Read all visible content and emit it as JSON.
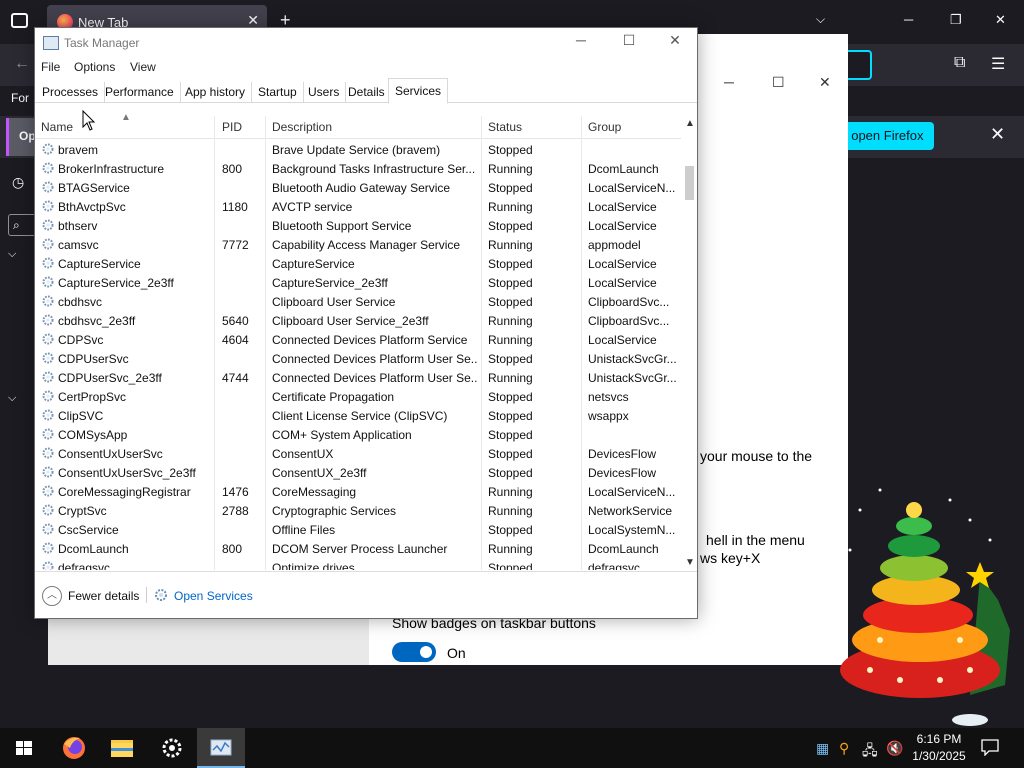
{
  "firefox": {
    "tab_title": "New Tab",
    "new_tab_symbol": "+",
    "sidebar_for": "For",
    "notif_op": "Op",
    "open_button": ", open Firefox",
    "window_controls": [
      "minimize-icon",
      "restore-icon",
      "close-icon"
    ]
  },
  "settings": {
    "mouse_text": "your mouse to the",
    "shell_text": "hell in the menu",
    "winx_text": "ws key+X",
    "badges_label": "Show badges on taskbar buttons",
    "toggle_state": "On"
  },
  "task_manager": {
    "title": "Task Manager",
    "menu": [
      "File",
      "Options",
      "View"
    ],
    "tabs": [
      "Processes",
      "Performance",
      "App history",
      "Startup",
      "Users",
      "Details",
      "Services"
    ],
    "active_tab": "Services",
    "columns": [
      "Name",
      "PID",
      "Description",
      "Status",
      "Group"
    ],
    "services": [
      {
        "name": "bravem",
        "pid": "",
        "description": "Brave Update Service (bravem)",
        "status": "Stopped",
        "group": ""
      },
      {
        "name": "BrokerInfrastructure",
        "pid": "800",
        "description": "Background Tasks Infrastructure Ser...",
        "status": "Running",
        "group": "DcomLaunch"
      },
      {
        "name": "BTAGService",
        "pid": "",
        "description": "Bluetooth Audio Gateway Service",
        "status": "Stopped",
        "group": "LocalServiceN..."
      },
      {
        "name": "BthAvctpSvc",
        "pid": "1180",
        "description": "AVCTP service",
        "status": "Running",
        "group": "LocalService"
      },
      {
        "name": "bthserv",
        "pid": "",
        "description": "Bluetooth Support Service",
        "status": "Stopped",
        "group": "LocalService"
      },
      {
        "name": "camsvc",
        "pid": "7772",
        "description": "Capability Access Manager Service",
        "status": "Running",
        "group": "appmodel"
      },
      {
        "name": "CaptureService",
        "pid": "",
        "description": "CaptureService",
        "status": "Stopped",
        "group": "LocalService"
      },
      {
        "name": "CaptureService_2e3ff",
        "pid": "",
        "description": "CaptureService_2e3ff",
        "status": "Stopped",
        "group": "LocalService"
      },
      {
        "name": "cbdhsvc",
        "pid": "",
        "description": "Clipboard User Service",
        "status": "Stopped",
        "group": "ClipboardSvc..."
      },
      {
        "name": "cbdhsvc_2e3ff",
        "pid": "5640",
        "description": "Clipboard User Service_2e3ff",
        "status": "Running",
        "group": "ClipboardSvc..."
      },
      {
        "name": "CDPSvc",
        "pid": "4604",
        "description": "Connected Devices Platform Service",
        "status": "Running",
        "group": "LocalService"
      },
      {
        "name": "CDPUserSvc",
        "pid": "",
        "description": "Connected Devices Platform User Se...",
        "status": "Stopped",
        "group": "UnistackSvcGr..."
      },
      {
        "name": "CDPUserSvc_2e3ff",
        "pid": "4744",
        "description": "Connected Devices Platform User Se...",
        "status": "Running",
        "group": "UnistackSvcGr..."
      },
      {
        "name": "CertPropSvc",
        "pid": "",
        "description": "Certificate Propagation",
        "status": "Stopped",
        "group": "netsvcs"
      },
      {
        "name": "ClipSVC",
        "pid": "",
        "description": "Client License Service (ClipSVC)",
        "status": "Stopped",
        "group": "wsappx"
      },
      {
        "name": "COMSysApp",
        "pid": "",
        "description": "COM+ System Application",
        "status": "Stopped",
        "group": ""
      },
      {
        "name": "ConsentUxUserSvc",
        "pid": "",
        "description": "ConsentUX",
        "status": "Stopped",
        "group": "DevicesFlow"
      },
      {
        "name": "ConsentUxUserSvc_2e3ff",
        "pid": "",
        "description": "ConsentUX_2e3ff",
        "status": "Stopped",
        "group": "DevicesFlow"
      },
      {
        "name": "CoreMessagingRegistrar",
        "pid": "1476",
        "description": "CoreMessaging",
        "status": "Running",
        "group": "LocalServiceN..."
      },
      {
        "name": "CryptSvc",
        "pid": "2788",
        "description": "Cryptographic Services",
        "status": "Running",
        "group": "NetworkService"
      },
      {
        "name": "CscService",
        "pid": "",
        "description": "Offline Files",
        "status": "Stopped",
        "group": "LocalSystemN..."
      },
      {
        "name": "DcomLaunch",
        "pid": "800",
        "description": "DCOM Server Process Launcher",
        "status": "Running",
        "group": "DcomLaunch"
      },
      {
        "name": "defragsvc",
        "pid": "",
        "description": "Optimize drives",
        "status": "Stopped",
        "group": "defragsvc"
      }
    ],
    "fewer_details": "Fewer details",
    "open_services": "Open Services"
  },
  "taskbar": {
    "time": "6:16 PM",
    "date": "1/30/2025",
    "pinned": [
      "windows-start-icon",
      "firefox-icon",
      "file-explorer-icon",
      "settings-gear-icon",
      "task-manager-icon"
    ],
    "active_app": "task-manager-icon"
  }
}
